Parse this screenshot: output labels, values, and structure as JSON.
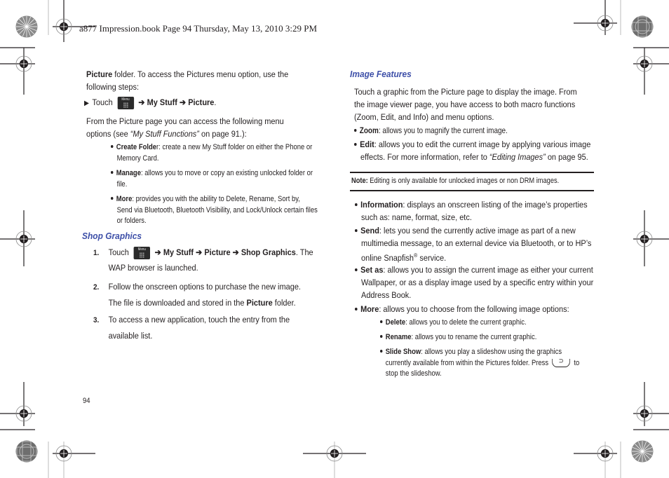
{
  "header": {
    "book_line": "a877 Impression.book  Page 94  Thursday, May 13, 2010  3:29 PM"
  },
  "left_column": {
    "intro": {
      "bold_word": "Picture",
      "rest_line1": " folder. To access the Pictures menu option, use the",
      "line2": "following steps:"
    },
    "step_touch": {
      "arrow_glyph": "▶",
      "touch_label": "Touch",
      "menu_icon_label": "Menu",
      "path": "➔ My Stuff ➔ Picture",
      "period": "."
    },
    "from_picture": {
      "line1": "From the Picture page you can access the following menu",
      "line2_prefix": "options (see ",
      "line2_ref": "“My Stuff Functions”",
      "line2_suffix": " on page 91.):"
    },
    "options": [
      {
        "term": "Create Folde",
        "desc_line1": "r: create a new My Stuff folder on either the Phone or",
        "desc_line2": "Memory Card."
      },
      {
        "term": "Manage",
        "desc_line1": ": allows you to move or copy an existing unlocked folder or",
        "desc_line2": "file."
      },
      {
        "term": "More",
        "desc_line1": ": provides you with the ability to Delete, Rename, Sort by,",
        "desc_line2": "Send via Bluetooth, Bluetooth Visibility, and Lock/Unlock certain files",
        "desc_line3": "or folders."
      }
    ],
    "shop_graphics": {
      "heading": "Shop Graphics",
      "steps": [
        {
          "num": "1.",
          "touch_label": "Touch",
          "menu_icon_label": "Menu",
          "path": "➔ My Stuff ➔ Picture ➔ Shop Graphics",
          "after": ". The",
          "line2": "WAP browser is launched."
        },
        {
          "num": "2.",
          "line1": "Follow the onscreen options to purchase the new image.",
          "line2_prefix": "The file is downloaded and stored in the ",
          "line2_bold": "Picture",
          "line2_suffix": " folder."
        },
        {
          "num": "3.",
          "line1": "To access a new application, touch the entry from the",
          "line2": "available list."
        }
      ]
    },
    "page_number": "94"
  },
  "right_column": {
    "image_features": {
      "heading": "Image Features",
      "intro_lines": [
        "Touch a graphic from the Picture page to display the image. From",
        "the image viewer page, you have access to both macro functions",
        "(Zoom, Edit, and Info) and menu options."
      ],
      "zoom": {
        "term": "Zoom",
        "desc": ": allows you to magnify the current image."
      },
      "edit": {
        "term": "Edit",
        "desc_line1": ": allows you to edit the current image by applying various image",
        "desc_line2_prefix": "effects. For more information, refer to ",
        "desc_line2_ref": "“Editing Images”",
        "desc_line2_suffix": "  on page 95."
      }
    },
    "note": {
      "label": "Note:",
      "text": " Editing is only available for unlocked images or non DRM images."
    },
    "items": [
      {
        "term": "Information",
        "desc_line1": ": displays an onscreen listing of the image’s properties",
        "desc_line2": "such as: name, format, size, etc."
      },
      {
        "term": "Send",
        "desc_line1": ": lets you send the currently active image as part of a new",
        "desc_line2": "multimedia message, to an external device via Bluetooth, or to HP’s",
        "desc_line3_prefix": "online Snapfish",
        "desc_line3_sup": "®",
        "desc_line3_suffix": " service."
      },
      {
        "term": "Set as",
        "desc_line1": ": allows you to assign the current image as either your current",
        "desc_line2": "Wallpaper, or as a display image used by a specific entry within your",
        "desc_line3": "Address Book."
      },
      {
        "term": "More",
        "desc_line1": ": allows you to choose from the following image options:"
      }
    ],
    "more_options": [
      {
        "term": "Delete",
        "desc": ": allows you to delete the current graphic."
      },
      {
        "term": "Rename",
        "desc": ": allows you to rename the current graphic."
      },
      {
        "term": "Slide Show",
        "desc_line1": ": allows you play a slideshow using the graphics",
        "desc_line2_prefix": "currently available from within the Pictures folder. Press ",
        "back_key_glyph": "⊃",
        "desc_line2_suffix": " to",
        "desc_line3": "stop the slideshow."
      }
    ]
  },
  "colors": {
    "heading_blue": "#3d4fa8",
    "text": "#231f20"
  }
}
